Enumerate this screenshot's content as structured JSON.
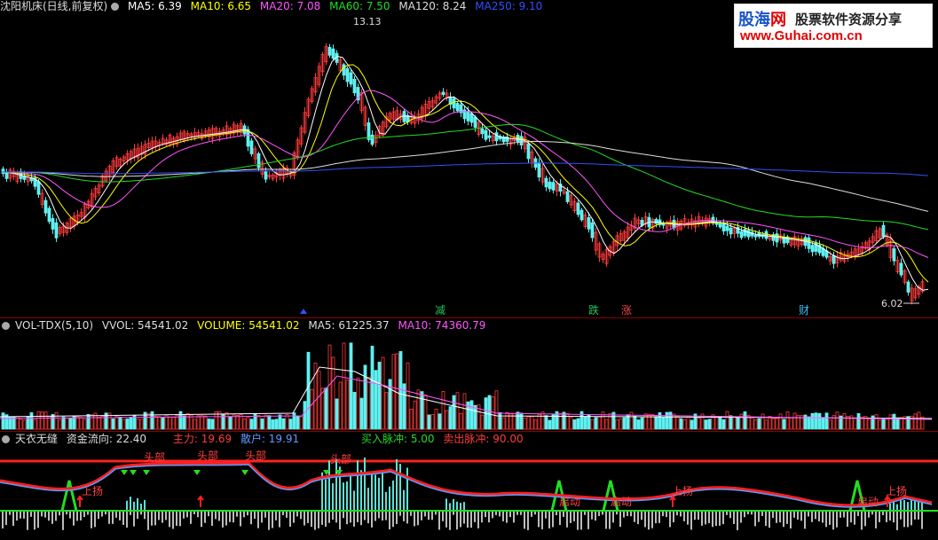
{
  "price_header": {
    "title": "沈阳机床(日线,前复权)",
    "ma5": "MA5: 6.39",
    "ma10": "MA10: 6.65",
    "ma20": "MA20: 7.08",
    "ma60": "MA60: 7.50",
    "ma120": "MA120: 8.24",
    "ma250": "MA250: 9.10"
  },
  "price_annotations": {
    "high": "13.13",
    "low": "6.02"
  },
  "event_markers": [
    {
      "label": "减",
      "color": "#22c55e"
    },
    {
      "label": "跌",
      "color": "#22c55e"
    },
    {
      "label": "涨",
      "color": "#ef4444"
    },
    {
      "label": "财",
      "color": "#38bdf8"
    }
  ],
  "volume_header": {
    "title": "VOL-TDX(5,10)",
    "vvol": "VVOL: 54541.02",
    "volume": "VOLUME: 54541.02",
    "ma5": "MA5: 61225.37",
    "ma10": "MA10: 74360.79"
  },
  "indicator_header": {
    "title": "天衣无缝",
    "flow": "资金流向: 22.40",
    "main": "主力: 19.69",
    "retail": "散户: 19.91",
    "buy": "买入脉冲: 5.00",
    "sell": "卖出脉冲: 90.00"
  },
  "indicator_labels": {
    "up1": "上扬",
    "top1": "头部",
    "top2": "头部",
    "top3": "头部",
    "top4": "头部",
    "move1": "启动",
    "move2": "启动",
    "up2": "上扬",
    "move3": "启动",
    "up3": "上扬"
  },
  "logo": {
    "name_a": "股海",
    "name_b": "网",
    "slogan": "股票软件资源分享",
    "url": "www.Guhai.com.cn"
  },
  "colors": {
    "up": "#ff3b3b",
    "down": "#5ff0f0",
    "ma5": "#ffffff",
    "ma10": "#ffff00",
    "ma20": "#ff55ff",
    "ma60": "#22dd22",
    "ma120": "#dddddd",
    "ma250": "#3050ff"
  }
}
